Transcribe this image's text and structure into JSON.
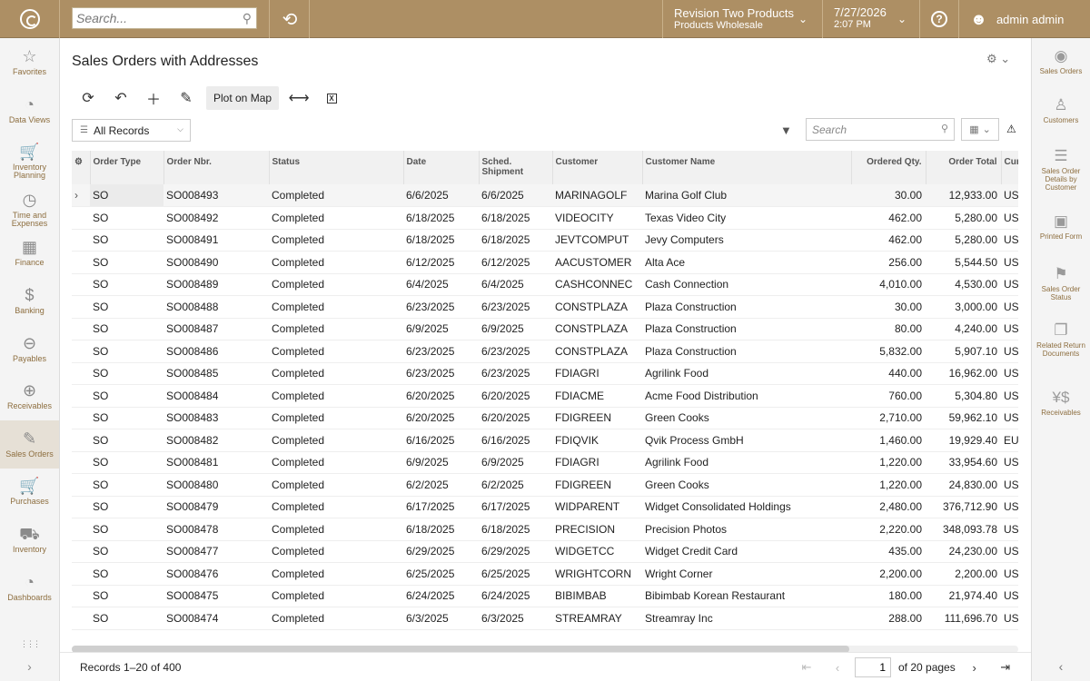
{
  "topbar": {
    "search_placeholder": "Search...",
    "tenant_name": "Revision Two Products",
    "tenant_branch": "Products Wholesale",
    "date": "7/27/2026",
    "time": "2:07 PM",
    "help_symbol": "?",
    "user_name": "admin admin"
  },
  "leftnav": [
    {
      "label": "Favorites",
      "icon": "☆"
    },
    {
      "label": "Data Views",
      "icon": "◔"
    },
    {
      "label": "Inventory Planning",
      "icon": "🛒"
    },
    {
      "label": "Time and Expenses",
      "icon": "◷"
    },
    {
      "label": "Finance",
      "icon": "▦"
    },
    {
      "label": "Banking",
      "icon": "$"
    },
    {
      "label": "Payables",
      "icon": "⊖"
    },
    {
      "label": "Receivables",
      "icon": "⊕"
    },
    {
      "label": "Sales Orders",
      "icon": "✎"
    },
    {
      "label": "Purchases",
      "icon": "🛒"
    },
    {
      "label": "Inventory",
      "icon": "⛟"
    },
    {
      "label": "Dashboards",
      "icon": "◔"
    }
  ],
  "rightnav": [
    {
      "label": "Sales Orders",
      "icon": "◉"
    },
    {
      "label": "Customers",
      "icon": "♙"
    },
    {
      "label": "Sales Order Details by Customer",
      "icon": "☰"
    },
    {
      "label": "Printed Form",
      "icon": "▣"
    },
    {
      "label": "Sales Order Status",
      "icon": "⚑"
    },
    {
      "label": "Related Return Documents",
      "icon": "❐"
    },
    {
      "label": "Receivables",
      "icon": "¥$"
    }
  ],
  "page": {
    "title": "Sales Orders with Addresses",
    "plot_on_map": "Plot on Map",
    "filter_value": "All Records",
    "grid_search_placeholder": "Search",
    "records_text": "Records 1–20 of 400",
    "page_number": "1",
    "of_pages": "of 20 pages"
  },
  "columns": [
    "Order Type",
    "Order Nbr.",
    "Status",
    "Date",
    "Sched. Shipment",
    "Customer",
    "Customer Name",
    "Ordered Qty.",
    "Order Total",
    "Cur"
  ],
  "rows": [
    [
      "SO",
      "SO008493",
      "Completed",
      "6/6/2025",
      "6/6/2025",
      "MARINAGOLF",
      "Marina Golf Club",
      "30.00",
      "12,933.00",
      "US"
    ],
    [
      "SO",
      "SO008492",
      "Completed",
      "6/18/2025",
      "6/18/2025",
      "VIDEOCITY",
      "Texas Video City",
      "462.00",
      "5,280.00",
      "US"
    ],
    [
      "SO",
      "SO008491",
      "Completed",
      "6/18/2025",
      "6/18/2025",
      "JEVTCOMPUT",
      "Jevy Computers",
      "462.00",
      "5,280.00",
      "US"
    ],
    [
      "SO",
      "SO008490",
      "Completed",
      "6/12/2025",
      "6/12/2025",
      "AACUSTOMER",
      "Alta Ace",
      "256.00",
      "5,544.50",
      "US"
    ],
    [
      "SO",
      "SO008489",
      "Completed",
      "6/4/2025",
      "6/4/2025",
      "CASHCONNEC",
      "Cash Connection",
      "4,010.00",
      "4,530.00",
      "US"
    ],
    [
      "SO",
      "SO008488",
      "Completed",
      "6/23/2025",
      "6/23/2025",
      "CONSTPLAZA",
      "Plaza Construction",
      "30.00",
      "3,000.00",
      "US"
    ],
    [
      "SO",
      "SO008487",
      "Completed",
      "6/9/2025",
      "6/9/2025",
      "CONSTPLAZA",
      "Plaza Construction",
      "80.00",
      "4,240.00",
      "US"
    ],
    [
      "SO",
      "SO008486",
      "Completed",
      "6/23/2025",
      "6/23/2025",
      "CONSTPLAZA",
      "Plaza Construction",
      "5,832.00",
      "5,907.10",
      "US"
    ],
    [
      "SO",
      "SO008485",
      "Completed",
      "6/23/2025",
      "6/23/2025",
      "FDIAGRI",
      "Agrilink Food",
      "440.00",
      "16,962.00",
      "US"
    ],
    [
      "SO",
      "SO008484",
      "Completed",
      "6/20/2025",
      "6/20/2025",
      "FDIACME",
      "Acme Food Distribution",
      "760.00",
      "5,304.80",
      "US"
    ],
    [
      "SO",
      "SO008483",
      "Completed",
      "6/20/2025",
      "6/20/2025",
      "FDIGREEN",
      "Green Cooks",
      "2,710.00",
      "59,962.10",
      "US"
    ],
    [
      "SO",
      "SO008482",
      "Completed",
      "6/16/2025",
      "6/16/2025",
      "FDIQVIK",
      "Qvik Process GmbH",
      "1,460.00",
      "19,929.40",
      "EU"
    ],
    [
      "SO",
      "SO008481",
      "Completed",
      "6/9/2025",
      "6/9/2025",
      "FDIAGRI",
      "Agrilink Food",
      "1,220.00",
      "33,954.60",
      "US"
    ],
    [
      "SO",
      "SO008480",
      "Completed",
      "6/2/2025",
      "6/2/2025",
      "FDIGREEN",
      "Green Cooks",
      "1,220.00",
      "24,830.00",
      "US"
    ],
    [
      "SO",
      "SO008479",
      "Completed",
      "6/17/2025",
      "6/17/2025",
      "WIDPARENT",
      "Widget Consolidated Holdings",
      "2,480.00",
      "376,712.90",
      "US"
    ],
    [
      "SO",
      "SO008478",
      "Completed",
      "6/18/2025",
      "6/18/2025",
      "PRECISION",
      "Precision Photos",
      "2,220.00",
      "348,093.78",
      "US"
    ],
    [
      "SO",
      "SO008477",
      "Completed",
      "6/29/2025",
      "6/29/2025",
      "WIDGETCC",
      "Widget Credit Card",
      "435.00",
      "24,230.00",
      "US"
    ],
    [
      "SO",
      "SO008476",
      "Completed",
      "6/25/2025",
      "6/25/2025",
      "WRIGHTCORN",
      "Wright Corner",
      "2,200.00",
      "2,200.00",
      "US"
    ],
    [
      "SO",
      "SO008475",
      "Completed",
      "6/24/2025",
      "6/24/2025",
      "BIBIMBAB",
      "Bibimbab Korean Restaurant",
      "180.00",
      "21,974.40",
      "US"
    ],
    [
      "SO",
      "SO008474",
      "Completed",
      "6/3/2025",
      "6/3/2025",
      "STREAMRAY",
      "Streamray Inc",
      "288.00",
      "111,696.70",
      "US"
    ]
  ],
  "colors": {
    "topbar": "#ad8f64",
    "nav_label": "#8d6e3f"
  }
}
